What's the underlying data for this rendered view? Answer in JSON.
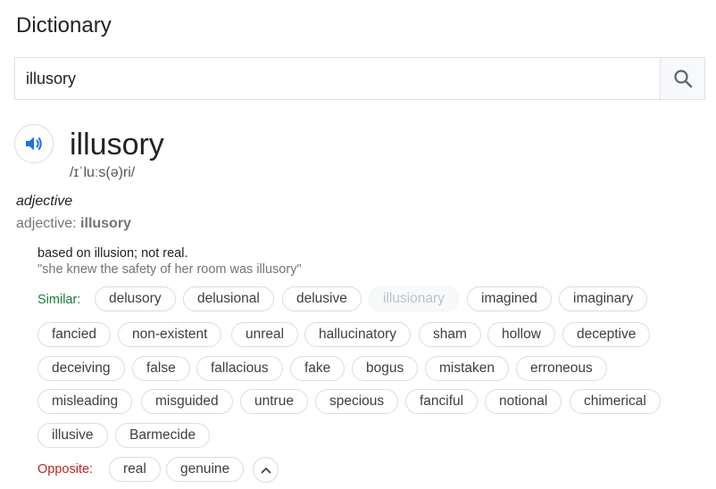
{
  "header": {
    "title": "Dictionary"
  },
  "search": {
    "value": "illusory",
    "icon": "search-icon"
  },
  "entry": {
    "word": "illusory",
    "phonetic": "/ɪˈluːs(ə)ri/",
    "pronounce_icon": "speaker-icon",
    "part_of_speech": "adjective",
    "pos_prefix": "adjective: ",
    "pos_word": "illusory",
    "definition": "based on illusion; not real.",
    "example": "\"she knew the safety of her room was illusory\""
  },
  "similar": {
    "label": "Similar:",
    "words": [
      "delusory",
      "delusional",
      "delusive",
      "illusionary",
      "imagined",
      "imaginary",
      "fancied",
      "non-existent",
      "unreal",
      "hallucinatory",
      "sham",
      "hollow",
      "deceptive",
      "deceiving",
      "false",
      "fallacious",
      "fake",
      "bogus",
      "mistaken",
      "erroneous",
      "misleading",
      "misguided",
      "untrue",
      "specious",
      "fanciful",
      "notional",
      "chimerical",
      "illusive",
      "Barmecide"
    ]
  },
  "opposite": {
    "label": "Opposite:",
    "words": [
      "real",
      "genuine"
    ],
    "collapse_icon": "chevron-up-icon"
  },
  "colors": {
    "similar_label": "#188038",
    "opposite_label": "#c5221f",
    "speaker_icon": "#1a73e8",
    "chip_border": "#dadce0"
  }
}
